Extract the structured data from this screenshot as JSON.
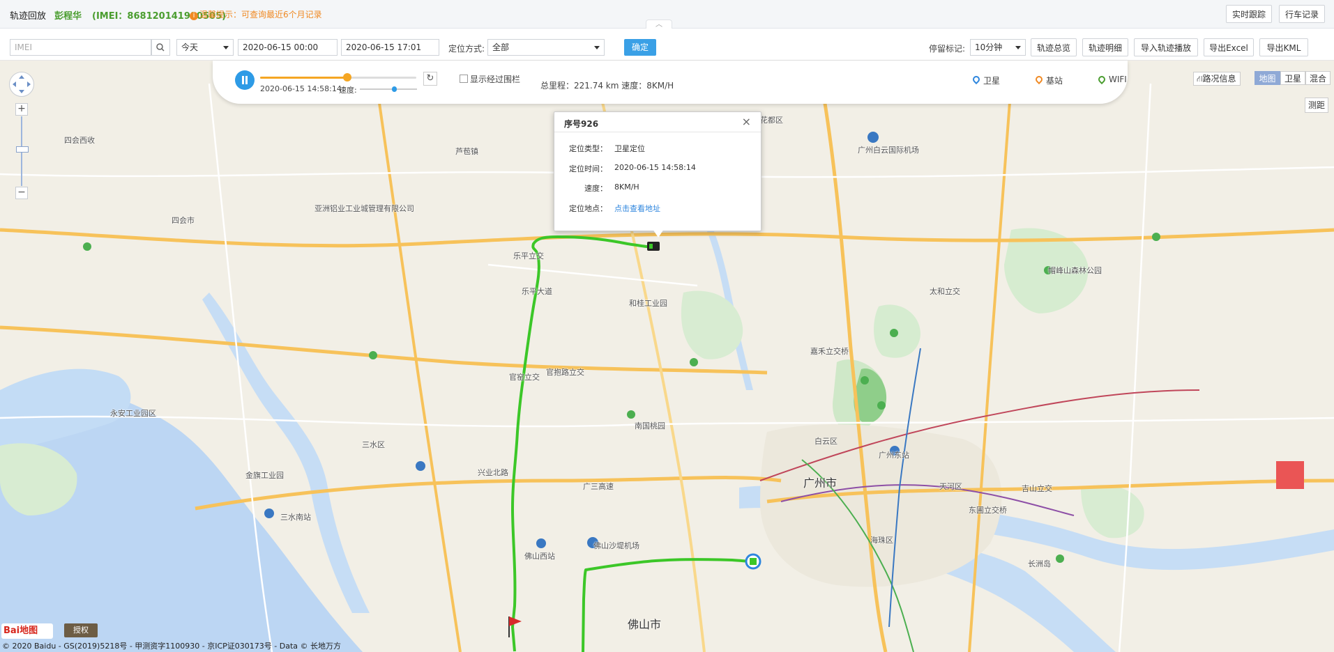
{
  "header": {
    "title": "轨迹回放",
    "user": "彭程华",
    "imei": "(IMEI：868120141980505)",
    "tip": "温馨提示：可查询最近6个月记录",
    "realtime_button": "实时跟踪",
    "trip_button": "行车记录"
  },
  "toolbar": {
    "imei_placeholder": "IMEI",
    "period": "今天",
    "start_time": "2020-06-15 00:00",
    "end_time": "2020-06-15 17:01",
    "locate_label": "定位方式:",
    "locate_value": "全部",
    "confirm": "确定",
    "stop_label": "停留标记:",
    "stop_value": "10分钟",
    "buttons": [
      "轨迹总览",
      "轨迹明细",
      "导入轨迹播放",
      "导出Excel",
      "导出KML"
    ]
  },
  "playbar": {
    "timestamp": "2020-06-15 14:58:14",
    "speed_label": "速度:",
    "progress": 0.56,
    "speed_level": 0.6,
    "fence_label": "显示经过围栏",
    "stats": "总里程：221.74 km 速度：8KM/H",
    "legend": [
      {
        "label": "卫星",
        "color": "#2e86de"
      },
      {
        "label": "基站",
        "color": "#f08a24"
      },
      {
        "label": "WIFI",
        "color": "#4a9d2f"
      }
    ]
  },
  "map_controls": {
    "traffic": "路况信息",
    "types": [
      "地图",
      "卫星",
      "混合"
    ],
    "active_type": "地图",
    "ruler": "测距"
  },
  "popup": {
    "title": "序号926",
    "rows": [
      {
        "key": "定位类型：",
        "value": "卫星定位"
      },
      {
        "key": "定位时间：",
        "value": "2020-06-15 14:58:14"
      },
      {
        "key": "速度：",
        "value": "8KM/H"
      },
      {
        "key": "定位地点：",
        "value": "点击查看地址"
      }
    ]
  },
  "map_labels": [
    {
      "text": "广州市",
      "big": true
    },
    {
      "text": "佛山市",
      "big": true
    },
    {
      "text": "白云区"
    },
    {
      "text": "海珠区"
    },
    {
      "text": "天河区"
    },
    {
      "text": "三水区"
    },
    {
      "text": "四会市"
    },
    {
      "text": "四会西收"
    },
    {
      "text": "乐平立交"
    },
    {
      "text": "官窑立交"
    },
    {
      "text": "官抱路立交"
    },
    {
      "text": "广州东站"
    },
    {
      "text": "佛山西站"
    },
    {
      "text": "广州白云国际机场"
    },
    {
      "text": "佛山沙堤机场"
    },
    {
      "text": "和桂工业园"
    },
    {
      "text": "南国桃园"
    },
    {
      "text": "广三高速"
    },
    {
      "text": "兴业北路"
    },
    {
      "text": "乐平大道"
    },
    {
      "text": "帽峰山森林公园"
    },
    {
      "text": "长洲岛"
    },
    {
      "text": "芦苞镇"
    },
    {
      "text": "花都区"
    },
    {
      "text": "太和立交"
    },
    {
      "text": "嘉禾立交桥"
    },
    {
      "text": "东圃立交桥"
    },
    {
      "text": "吉山立交"
    },
    {
      "text": "三水南站"
    },
    {
      "text": "永安工业园区"
    },
    {
      "text": "金旗工业园"
    },
    {
      "text": "亚洲铝业工业城管理有限公司"
    }
  ],
  "footer": {
    "copyright": "© 2020 Baidu - GS(2019)5218号 - 甲测资字1100930 - 京ICP证030173号 - Data © 长地万方",
    "logo": "Bai地图",
    "auth": "授权"
  }
}
